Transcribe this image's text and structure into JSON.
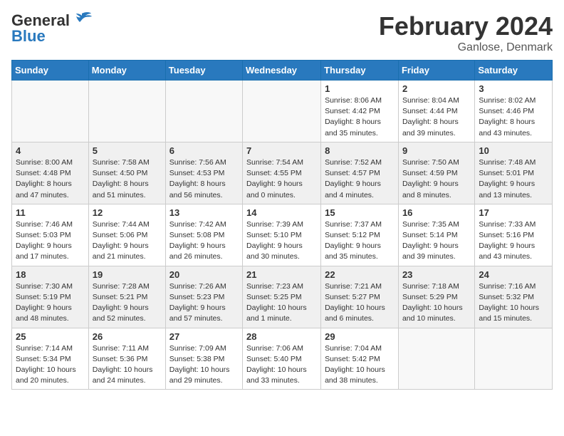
{
  "header": {
    "logo_general": "General",
    "logo_blue": "Blue",
    "title": "February 2024",
    "subtitle": "Ganlose, Denmark"
  },
  "weekdays": [
    "Sunday",
    "Monday",
    "Tuesday",
    "Wednesday",
    "Thursday",
    "Friday",
    "Saturday"
  ],
  "weeks": [
    [
      {
        "day": "",
        "info": ""
      },
      {
        "day": "",
        "info": ""
      },
      {
        "day": "",
        "info": ""
      },
      {
        "day": "",
        "info": ""
      },
      {
        "day": "1",
        "info": "Sunrise: 8:06 AM\nSunset: 4:42 PM\nDaylight: 8 hours\nand 35 minutes."
      },
      {
        "day": "2",
        "info": "Sunrise: 8:04 AM\nSunset: 4:44 PM\nDaylight: 8 hours\nand 39 minutes."
      },
      {
        "day": "3",
        "info": "Sunrise: 8:02 AM\nSunset: 4:46 PM\nDaylight: 8 hours\nand 43 minutes."
      }
    ],
    [
      {
        "day": "4",
        "info": "Sunrise: 8:00 AM\nSunset: 4:48 PM\nDaylight: 8 hours\nand 47 minutes."
      },
      {
        "day": "5",
        "info": "Sunrise: 7:58 AM\nSunset: 4:50 PM\nDaylight: 8 hours\nand 51 minutes."
      },
      {
        "day": "6",
        "info": "Sunrise: 7:56 AM\nSunset: 4:53 PM\nDaylight: 8 hours\nand 56 minutes."
      },
      {
        "day": "7",
        "info": "Sunrise: 7:54 AM\nSunset: 4:55 PM\nDaylight: 9 hours\nand 0 minutes."
      },
      {
        "day": "8",
        "info": "Sunrise: 7:52 AM\nSunset: 4:57 PM\nDaylight: 9 hours\nand 4 minutes."
      },
      {
        "day": "9",
        "info": "Sunrise: 7:50 AM\nSunset: 4:59 PM\nDaylight: 9 hours\nand 8 minutes."
      },
      {
        "day": "10",
        "info": "Sunrise: 7:48 AM\nSunset: 5:01 PM\nDaylight: 9 hours\nand 13 minutes."
      }
    ],
    [
      {
        "day": "11",
        "info": "Sunrise: 7:46 AM\nSunset: 5:03 PM\nDaylight: 9 hours\nand 17 minutes."
      },
      {
        "day": "12",
        "info": "Sunrise: 7:44 AM\nSunset: 5:06 PM\nDaylight: 9 hours\nand 21 minutes."
      },
      {
        "day": "13",
        "info": "Sunrise: 7:42 AM\nSunset: 5:08 PM\nDaylight: 9 hours\nand 26 minutes."
      },
      {
        "day": "14",
        "info": "Sunrise: 7:39 AM\nSunset: 5:10 PM\nDaylight: 9 hours\nand 30 minutes."
      },
      {
        "day": "15",
        "info": "Sunrise: 7:37 AM\nSunset: 5:12 PM\nDaylight: 9 hours\nand 35 minutes."
      },
      {
        "day": "16",
        "info": "Sunrise: 7:35 AM\nSunset: 5:14 PM\nDaylight: 9 hours\nand 39 minutes."
      },
      {
        "day": "17",
        "info": "Sunrise: 7:33 AM\nSunset: 5:16 PM\nDaylight: 9 hours\nand 43 minutes."
      }
    ],
    [
      {
        "day": "18",
        "info": "Sunrise: 7:30 AM\nSunset: 5:19 PM\nDaylight: 9 hours\nand 48 minutes."
      },
      {
        "day": "19",
        "info": "Sunrise: 7:28 AM\nSunset: 5:21 PM\nDaylight: 9 hours\nand 52 minutes."
      },
      {
        "day": "20",
        "info": "Sunrise: 7:26 AM\nSunset: 5:23 PM\nDaylight: 9 hours\nand 57 minutes."
      },
      {
        "day": "21",
        "info": "Sunrise: 7:23 AM\nSunset: 5:25 PM\nDaylight: 10 hours\nand 1 minute."
      },
      {
        "day": "22",
        "info": "Sunrise: 7:21 AM\nSunset: 5:27 PM\nDaylight: 10 hours\nand 6 minutes."
      },
      {
        "day": "23",
        "info": "Sunrise: 7:18 AM\nSunset: 5:29 PM\nDaylight: 10 hours\nand 10 minutes."
      },
      {
        "day": "24",
        "info": "Sunrise: 7:16 AM\nSunset: 5:32 PM\nDaylight: 10 hours\nand 15 minutes."
      }
    ],
    [
      {
        "day": "25",
        "info": "Sunrise: 7:14 AM\nSunset: 5:34 PM\nDaylight: 10 hours\nand 20 minutes."
      },
      {
        "day": "26",
        "info": "Sunrise: 7:11 AM\nSunset: 5:36 PM\nDaylight: 10 hours\nand 24 minutes."
      },
      {
        "day": "27",
        "info": "Sunrise: 7:09 AM\nSunset: 5:38 PM\nDaylight: 10 hours\nand 29 minutes."
      },
      {
        "day": "28",
        "info": "Sunrise: 7:06 AM\nSunset: 5:40 PM\nDaylight: 10 hours\nand 33 minutes."
      },
      {
        "day": "29",
        "info": "Sunrise: 7:04 AM\nSunset: 5:42 PM\nDaylight: 10 hours\nand 38 minutes."
      },
      {
        "day": "",
        "info": ""
      },
      {
        "day": "",
        "info": ""
      }
    ]
  ]
}
